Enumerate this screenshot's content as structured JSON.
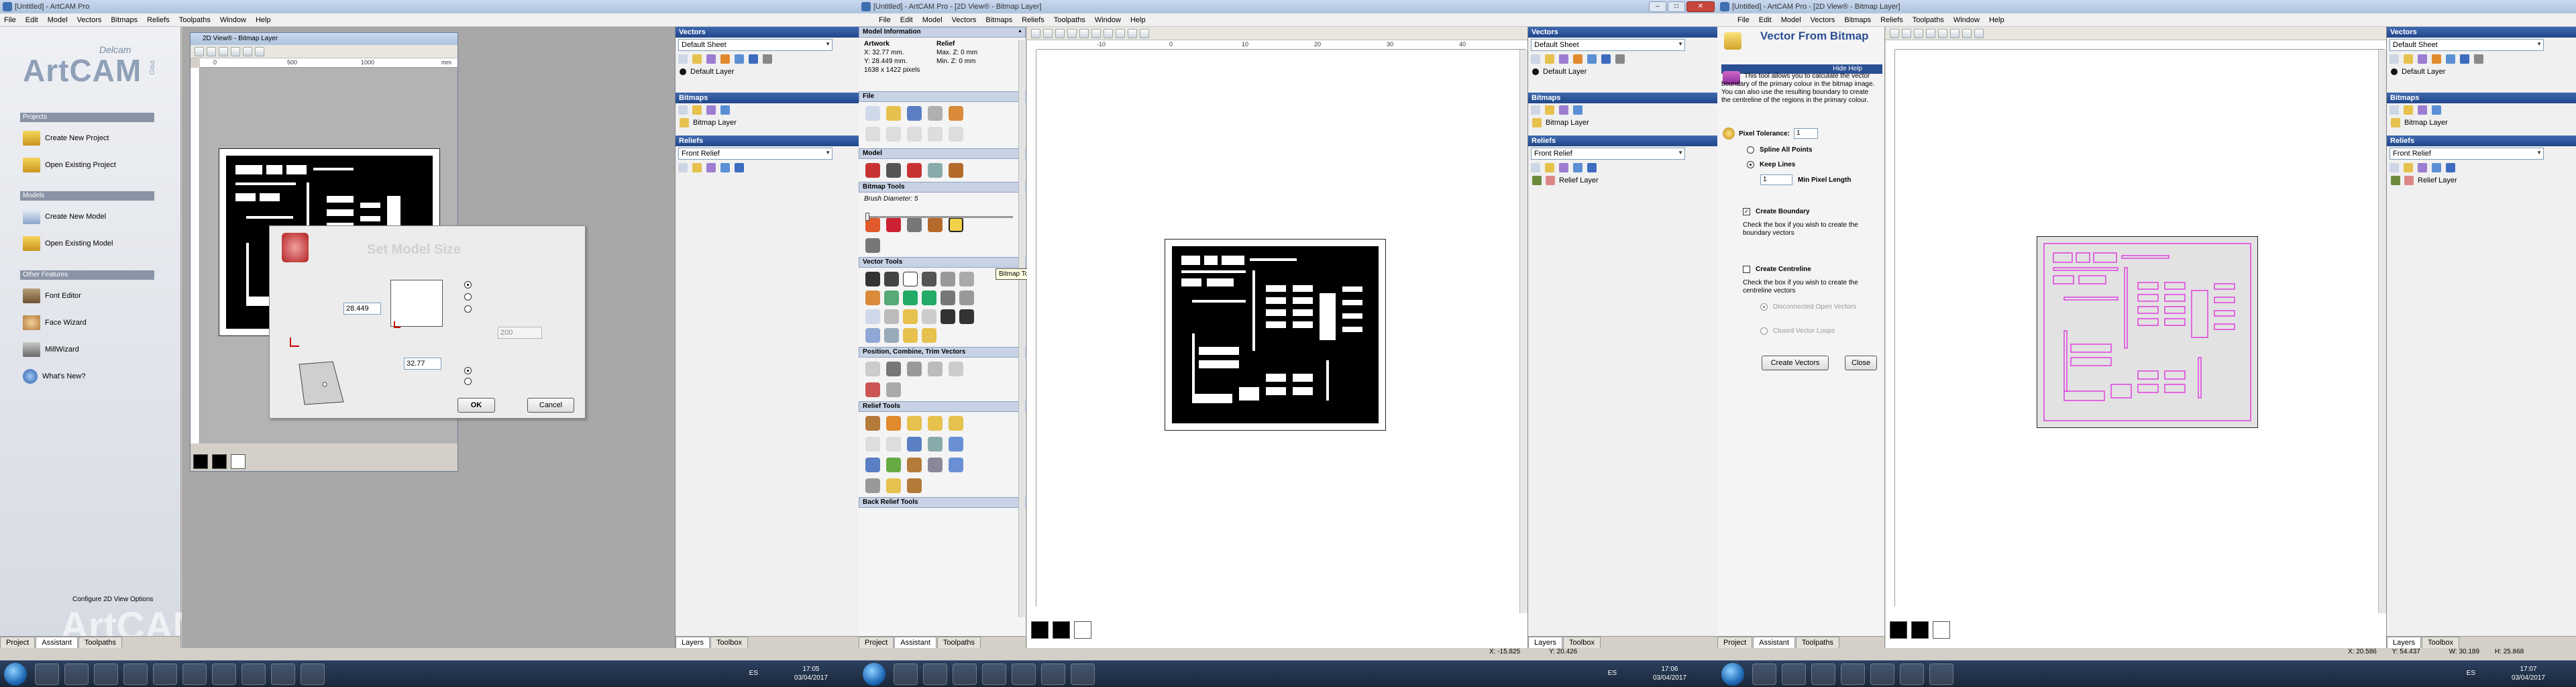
{
  "screen1": {
    "title": "[Untitled] - ArtCAM Pro",
    "menu": [
      "File",
      "Edit",
      "Model",
      "Vectors",
      "Bitmaps",
      "Reliefs",
      "Toolpaths",
      "Window",
      "Help"
    ],
    "logo": {
      "brand": "Delcam",
      "name": "ArtCAM",
      "edition": "PRO"
    },
    "projects_header": "Projects",
    "create_new_project": "Create New Project",
    "open_existing_project": "Open Existing Project",
    "models_header": "Models",
    "create_new_model": "Create New Model",
    "open_existing_model": "Open Existing Model",
    "other_header": "Other Features",
    "font_editor": "Font Editor",
    "face_wizard": "Face Wizard",
    "mill_wizard": "MillWizard",
    "whats_new": "What's New?",
    "configure_view": "Configure 2D View Options",
    "watermark": "ArtCAM",
    "tabs": [
      "Project",
      "Assistant",
      "Toolpaths"
    ],
    "view_title": "2D View® - Bitmap Layer",
    "view_ruler": [
      "0",
      "500",
      "1000"
    ],
    "view_units": "mm",
    "dialog": {
      "title": "Set Model Size",
      "height_value": "28.449",
      "width_value": "32.77",
      "res_value": "200",
      "ok": "OK",
      "cancel": "Cancel"
    },
    "side_panels": {
      "vectors": "Vectors",
      "vector_sheet": "Default Sheet",
      "vector_layer": "Default Layer",
      "bitmaps": "Bitmaps",
      "bitmap_layer": "Bitmap Layer",
      "reliefs": "Reliefs",
      "relief_sel": "Front Relief"
    },
    "side_tabs": [
      "Layers",
      "Toolbox"
    ],
    "taskbar_lang": "ES",
    "time": "17:05",
    "date": "03/04/2017"
  },
  "screen2": {
    "title": "[Untitled] - ArtCAM Pro - [2D View® - Bitmap Layer]",
    "menu": [
      "File",
      "Edit",
      "Model",
      "Vectors",
      "Bitmaps",
      "Reliefs",
      "Toolpaths",
      "Window",
      "Help"
    ],
    "model_info": {
      "header": "Model Information",
      "artwork": "Artwork",
      "relief": "Relief",
      "x": "X: 32.77 mm.",
      "y": "Y: 28.449 mm.",
      "pixels": "1638 x 1422 pixels",
      "max_z": "Max. Z: 0 mm",
      "min_z": "Min. Z: 0 mm"
    },
    "sections": {
      "file": "File",
      "model": "Model",
      "bitmap_tools": "Bitmap Tools",
      "vector_tools": "Vector Tools",
      "position": "Position, Combine, Trim Vectors",
      "relief_tools": "Relief Tools",
      "back_relief_tools": "Back Relief Tools"
    },
    "brush_label": "Brush Diameter:",
    "brush_value": "5",
    "tooltip": "Bitmap To Vector",
    "ruler": [
      "-10",
      "0",
      "10",
      "20",
      "30",
      "40"
    ],
    "tabs": [
      "Project",
      "Assistant",
      "Toolpaths"
    ],
    "status_x": "X: -15.825",
    "side_panels": {
      "vectors": "Vectors",
      "vector_sheet": "Default Sheet",
      "vector_layer": "Default Layer",
      "bitmaps": "Bitmaps",
      "bitmap_layer": "Bitmap Layer",
      "reliefs": "Reliefs",
      "relief_sel": "Front Relief",
      "relief_layer": "Relief Layer"
    },
    "side_tabs": [
      "Layers",
      "Toolbox"
    ],
    "status_y": "Y: 20.426",
    "taskbar_lang": "ES",
    "time": "17:06",
    "date": "03/04/2017"
  },
  "screen3": {
    "title": "[Untitled] - ArtCAM Pro - [2D View® - Bitmap Layer]",
    "menu": [
      "File",
      "Edit",
      "Model",
      "Vectors",
      "Bitmaps",
      "Reliefs",
      "Toolpaths",
      "Window",
      "Help"
    ],
    "panel_title": "Vector From Bitmap",
    "hide_help": "Hide Help",
    "help_text": "This tool allows you to calculate the vector boundary of the primary colour in the bitmap image. You can also use the resulting boundary to create the centreline of the regions in the primary colour.",
    "pixel_tolerance": "Pixel Tolerance:",
    "pixel_tolerance_value": "1",
    "spline_all": "Spline All Points",
    "keep_lines": "Keep Lines",
    "min_pixel_value": "1",
    "min_pixel": "Min Pixel Length",
    "create_boundary": "Create Boundary",
    "boundary_help": "Check the box if you wish to create the boundary vectors",
    "create_centreline": "Create Centreline",
    "centreline_help": "Check the box if you wish to create the centreline vectors",
    "disconnected": "Disconnected Open Vectors",
    "closed_loops": "Closed Vector Loops",
    "create_vectors": "Create Vectors",
    "close": "Close",
    "tabs": [
      "Project",
      "Assistant",
      "Toolpaths"
    ],
    "status_x": "X: 20.586",
    "status_y": "Y: 54.437",
    "status_w": "W: 30.189",
    "status_h": "H: 25.868",
    "side_panels": {
      "vectors": "Vectors",
      "vector_sheet": "Default Sheet",
      "vector_layer": "Default Layer",
      "bitmaps": "Bitmaps",
      "bitmap_layer": "Bitmap Layer",
      "reliefs": "Reliefs",
      "relief_sel": "Front Relief",
      "relief_layer": "Relief Layer"
    },
    "side_tabs": [
      "Layers",
      "Toolbox"
    ],
    "taskbar_lang": "ES",
    "time": "17:07",
    "date": "03/04/2017"
  },
  "colors": {
    "panel_title": "#2b4f93",
    "vector_magenta": "#e040e0",
    "desktop": "#d4d0c8"
  }
}
